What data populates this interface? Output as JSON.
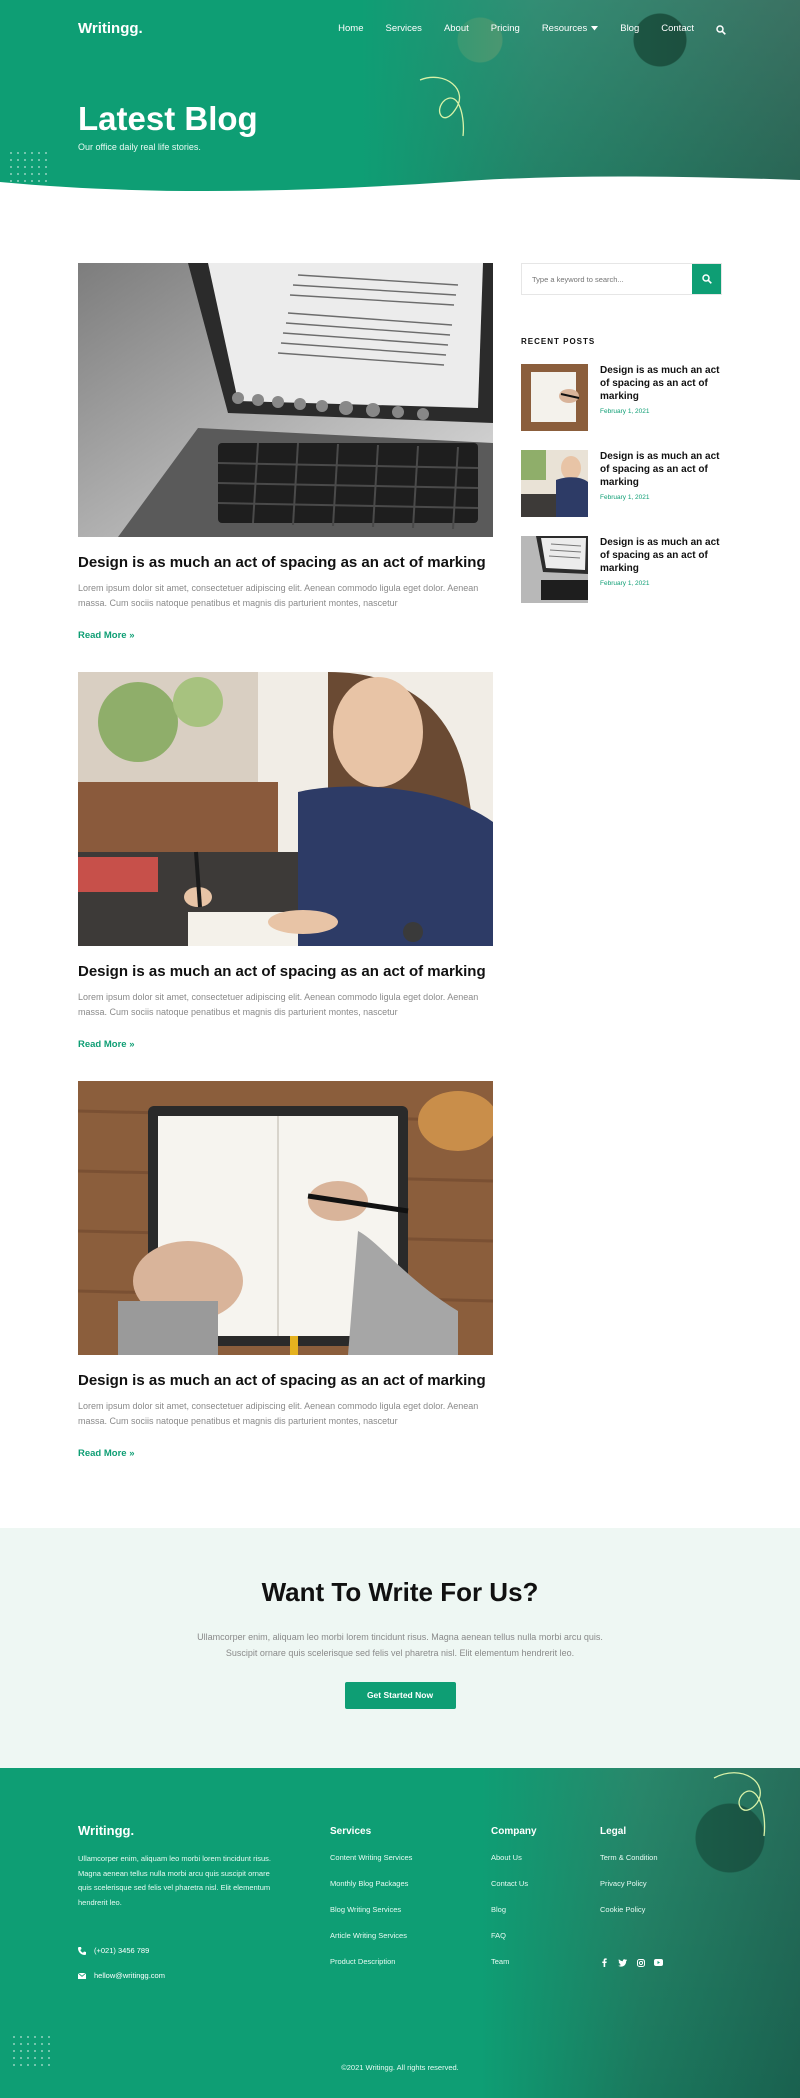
{
  "header": {
    "logo": "Writingg.",
    "nav": [
      "Home",
      "Services",
      "About",
      "Pricing",
      "Resources",
      "Blog",
      "Contact"
    ],
    "title": "Latest Blog",
    "subtitle": "Our office daily real life stories."
  },
  "posts": [
    {
      "title": "Design is as much an act of spacing as an act of marking",
      "excerpt": "Lorem ipsum dolor sit amet, consectetuer adipiscing elit. Aenean commodo ligula eget dolor. Aenean massa. Cum sociis natoque penatibus et magnis dis parturient montes, nascetur",
      "read_more": "Read More »",
      "image": "laptop-ebook-photo"
    },
    {
      "title": "Design is as much an act of spacing as an act of marking",
      "excerpt": "Lorem ipsum dolor sit amet, consectetuer adipiscing elit. Aenean commodo ligula eget dolor. Aenean massa. Cum sociis natoque penatibus et magnis dis parturient montes, nascetur",
      "read_more": "Read More »",
      "image": "woman-writing-photo"
    },
    {
      "title": "Design is as much an act of spacing as an act of marking",
      "excerpt": "Lorem ipsum dolor sit amet, consectetuer adipiscing elit. Aenean commodo ligula eget dolor. Aenean massa. Cum sociis natoque penatibus et magnis dis parturient montes, nascetur",
      "read_more": "Read More »",
      "image": "notebook-writing-photo"
    }
  ],
  "sidebar": {
    "search_placeholder": "Type a keyword to search...",
    "recent_heading": "RECENT POSTS",
    "recent": [
      {
        "title": "Design is as much an act of spacing as an act of marking",
        "date": "February 1, 2021"
      },
      {
        "title": "Design is as much an act of spacing as an act of marking",
        "date": "February 1, 2021"
      },
      {
        "title": "Design is as much an act of spacing as an act of marking",
        "date": "February 1, 2021"
      }
    ]
  },
  "cta": {
    "title": "Want To Write For Us?",
    "text": "Ullamcorper enim, aliquam leo morbi lorem tincidunt risus. Magna aenean tellus nulla morbi arcu quis. Suscipit ornare quis scelerisque sed felis vel pharetra nisl. Elit elementum hendrerit leo.",
    "button": "Get Started Now"
  },
  "footer": {
    "logo": "Writingg.",
    "about": "Ullamcorper enim, aliquam leo morbi lorem tincidunt risus. Magna aenean tellus nulla morbi arcu quis suscipit ornare quis scelerisque sed felis vel pharetra nisl. Elit elementum hendrerit leo.",
    "phone": "(+021) 3456 789",
    "email": "hellow@writingg.com",
    "columns": [
      {
        "title": "Services",
        "items": [
          "Content Writing Services",
          "Monthly Blog Packages",
          "Blog Writing Services",
          "Article Writing Services",
          "Product Description"
        ]
      },
      {
        "title": "Company",
        "items": [
          "About Us",
          "Contact Us",
          "Blog",
          "FAQ",
          "Team"
        ]
      },
      {
        "title": "Legal",
        "items": [
          "Term & Condition",
          "Privacy Policy",
          "Cookie Policy"
        ]
      }
    ],
    "social": [
      "facebook-icon",
      "twitter-icon",
      "instagram-icon",
      "youtube-icon"
    ],
    "copyright": "©2021 Writingg. All rights reserved."
  },
  "colors": {
    "brand": "#0e9e74",
    "cta_bg": "#eef7f3",
    "text_muted": "#8a8a8a"
  }
}
